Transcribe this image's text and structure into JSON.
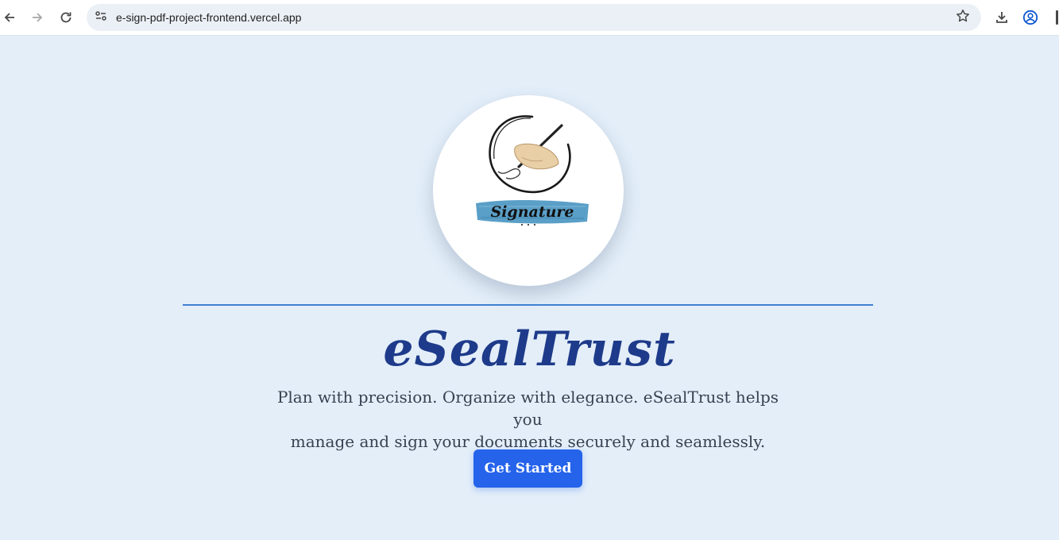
{
  "browser": {
    "url": "e-sign-pdf-project-frontend.vercel.app",
    "icons": [
      "back-icon",
      "forward-icon",
      "reload-icon",
      "site-info-icon",
      "bookmark-star-icon",
      "download-icon",
      "profile-icon"
    ]
  },
  "hero": {
    "logo_text": "Signature",
    "brand": "eSealTrust",
    "tagline_line1": "Plan with precision. Organize with elegance. eSealTrust helps you",
    "tagline_line2": "manage and sign your documents securely and seamlessly.",
    "cta_label": "Get Started"
  },
  "colors": {
    "page_background": "#e3eef9",
    "brand_text": "#1e3a8a",
    "divider": "#3f7fd0",
    "cta_background": "#2563eb",
    "tagline_text": "#374151",
    "logo_brush": "#5a9fc7"
  }
}
